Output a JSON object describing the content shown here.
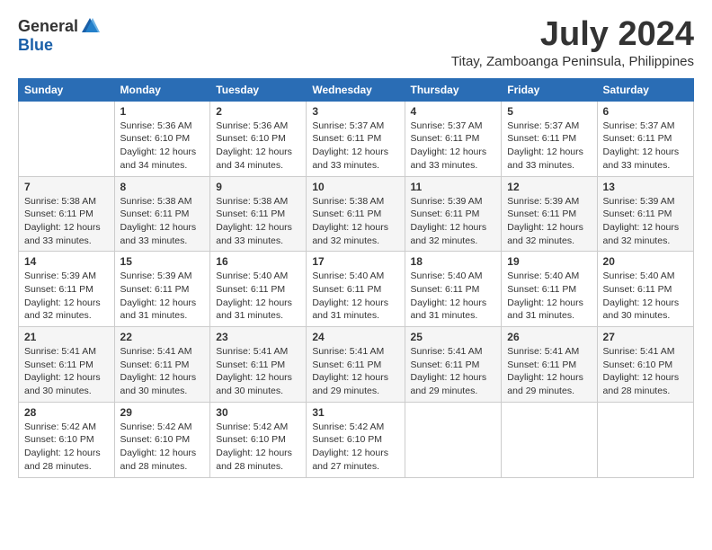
{
  "logo": {
    "general": "General",
    "blue": "Blue"
  },
  "title": "July 2024",
  "subtitle": "Titay, Zamboanga Peninsula, Philippines",
  "days_of_week": [
    "Sunday",
    "Monday",
    "Tuesday",
    "Wednesday",
    "Thursday",
    "Friday",
    "Saturday"
  ],
  "weeks": [
    [
      {
        "day": "",
        "info": ""
      },
      {
        "day": "1",
        "info": "Sunrise: 5:36 AM\nSunset: 6:10 PM\nDaylight: 12 hours\nand 34 minutes."
      },
      {
        "day": "2",
        "info": "Sunrise: 5:36 AM\nSunset: 6:10 PM\nDaylight: 12 hours\nand 34 minutes."
      },
      {
        "day": "3",
        "info": "Sunrise: 5:37 AM\nSunset: 6:11 PM\nDaylight: 12 hours\nand 33 minutes."
      },
      {
        "day": "4",
        "info": "Sunrise: 5:37 AM\nSunset: 6:11 PM\nDaylight: 12 hours\nand 33 minutes."
      },
      {
        "day": "5",
        "info": "Sunrise: 5:37 AM\nSunset: 6:11 PM\nDaylight: 12 hours\nand 33 minutes."
      },
      {
        "day": "6",
        "info": "Sunrise: 5:37 AM\nSunset: 6:11 PM\nDaylight: 12 hours\nand 33 minutes."
      }
    ],
    [
      {
        "day": "7",
        "info": "Sunrise: 5:38 AM\nSunset: 6:11 PM\nDaylight: 12 hours\nand 33 minutes."
      },
      {
        "day": "8",
        "info": "Sunrise: 5:38 AM\nSunset: 6:11 PM\nDaylight: 12 hours\nand 33 minutes."
      },
      {
        "day": "9",
        "info": "Sunrise: 5:38 AM\nSunset: 6:11 PM\nDaylight: 12 hours\nand 33 minutes."
      },
      {
        "day": "10",
        "info": "Sunrise: 5:38 AM\nSunset: 6:11 PM\nDaylight: 12 hours\nand 32 minutes."
      },
      {
        "day": "11",
        "info": "Sunrise: 5:39 AM\nSunset: 6:11 PM\nDaylight: 12 hours\nand 32 minutes."
      },
      {
        "day": "12",
        "info": "Sunrise: 5:39 AM\nSunset: 6:11 PM\nDaylight: 12 hours\nand 32 minutes."
      },
      {
        "day": "13",
        "info": "Sunrise: 5:39 AM\nSunset: 6:11 PM\nDaylight: 12 hours\nand 32 minutes."
      }
    ],
    [
      {
        "day": "14",
        "info": "Sunrise: 5:39 AM\nSunset: 6:11 PM\nDaylight: 12 hours\nand 32 minutes."
      },
      {
        "day": "15",
        "info": "Sunrise: 5:39 AM\nSunset: 6:11 PM\nDaylight: 12 hours\nand 31 minutes."
      },
      {
        "day": "16",
        "info": "Sunrise: 5:40 AM\nSunset: 6:11 PM\nDaylight: 12 hours\nand 31 minutes."
      },
      {
        "day": "17",
        "info": "Sunrise: 5:40 AM\nSunset: 6:11 PM\nDaylight: 12 hours\nand 31 minutes."
      },
      {
        "day": "18",
        "info": "Sunrise: 5:40 AM\nSunset: 6:11 PM\nDaylight: 12 hours\nand 31 minutes."
      },
      {
        "day": "19",
        "info": "Sunrise: 5:40 AM\nSunset: 6:11 PM\nDaylight: 12 hours\nand 31 minutes."
      },
      {
        "day": "20",
        "info": "Sunrise: 5:40 AM\nSunset: 6:11 PM\nDaylight: 12 hours\nand 30 minutes."
      }
    ],
    [
      {
        "day": "21",
        "info": "Sunrise: 5:41 AM\nSunset: 6:11 PM\nDaylight: 12 hours\nand 30 minutes."
      },
      {
        "day": "22",
        "info": "Sunrise: 5:41 AM\nSunset: 6:11 PM\nDaylight: 12 hours\nand 30 minutes."
      },
      {
        "day": "23",
        "info": "Sunrise: 5:41 AM\nSunset: 6:11 PM\nDaylight: 12 hours\nand 30 minutes."
      },
      {
        "day": "24",
        "info": "Sunrise: 5:41 AM\nSunset: 6:11 PM\nDaylight: 12 hours\nand 29 minutes."
      },
      {
        "day": "25",
        "info": "Sunrise: 5:41 AM\nSunset: 6:11 PM\nDaylight: 12 hours\nand 29 minutes."
      },
      {
        "day": "26",
        "info": "Sunrise: 5:41 AM\nSunset: 6:11 PM\nDaylight: 12 hours\nand 29 minutes."
      },
      {
        "day": "27",
        "info": "Sunrise: 5:41 AM\nSunset: 6:10 PM\nDaylight: 12 hours\nand 28 minutes."
      }
    ],
    [
      {
        "day": "28",
        "info": "Sunrise: 5:42 AM\nSunset: 6:10 PM\nDaylight: 12 hours\nand 28 minutes."
      },
      {
        "day": "29",
        "info": "Sunrise: 5:42 AM\nSunset: 6:10 PM\nDaylight: 12 hours\nand 28 minutes."
      },
      {
        "day": "30",
        "info": "Sunrise: 5:42 AM\nSunset: 6:10 PM\nDaylight: 12 hours\nand 28 minutes."
      },
      {
        "day": "31",
        "info": "Sunrise: 5:42 AM\nSunset: 6:10 PM\nDaylight: 12 hours\nand 27 minutes."
      },
      {
        "day": "",
        "info": ""
      },
      {
        "day": "",
        "info": ""
      },
      {
        "day": "",
        "info": ""
      }
    ]
  ]
}
